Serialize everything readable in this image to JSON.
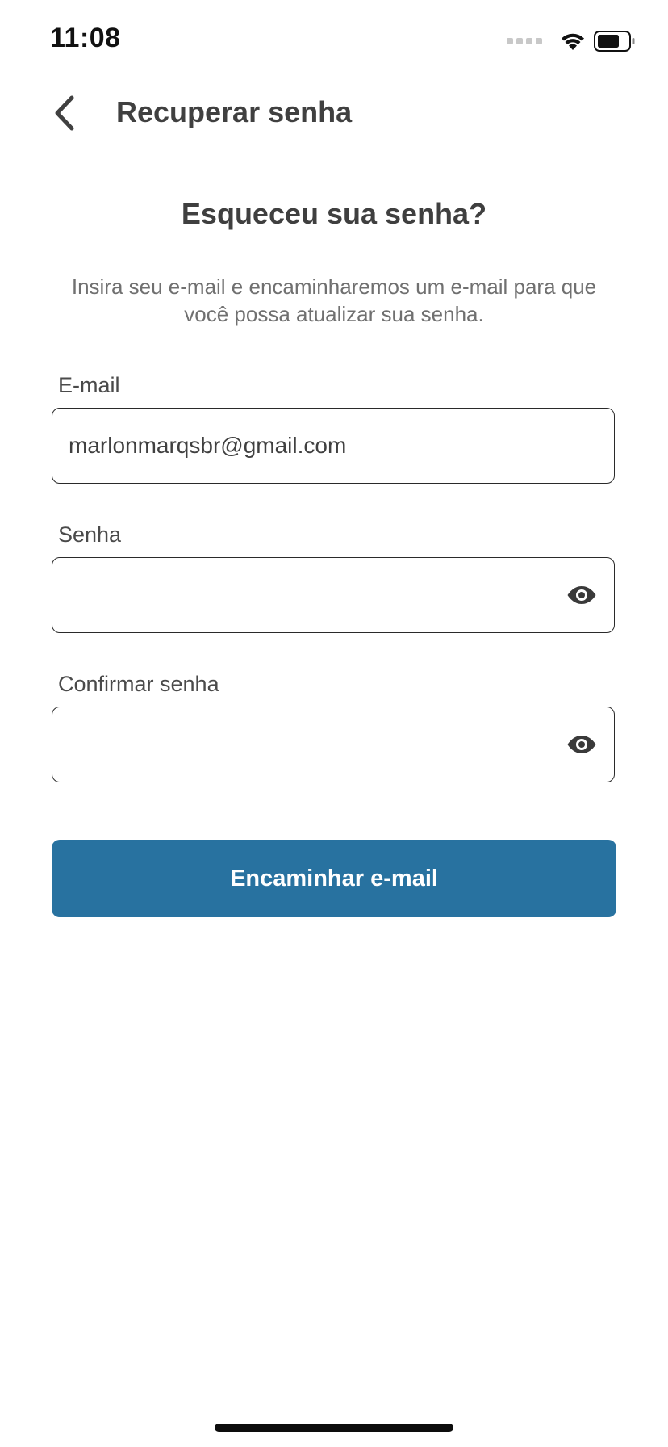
{
  "status_bar": {
    "time": "11:08",
    "icons": [
      "signal-dots-icon",
      "wifi-icon",
      "battery-icon"
    ]
  },
  "nav": {
    "back_icon": "chevron-left-icon",
    "title": "Recuperar senha"
  },
  "content": {
    "heading": "Esqueceu sua senha?",
    "description": "Insira seu e-mail e encaminharemos um e-mail para que você possa atualizar sua senha."
  },
  "form": {
    "email": {
      "label": "E-mail",
      "value": "marlonmarqsbr@gmail.com"
    },
    "password": {
      "label": "Senha",
      "value": "",
      "toggle_icon": "eye-icon"
    },
    "confirm_password": {
      "label": "Confirmar senha",
      "value": "",
      "toggle_icon": "eye-icon"
    }
  },
  "actions": {
    "submit_label": "Encaminhar e-mail"
  },
  "colors": {
    "primary_button": "#2872a0",
    "text_dark": "#3f3f3f",
    "text_muted": "#707070",
    "background": "#ffffff"
  }
}
